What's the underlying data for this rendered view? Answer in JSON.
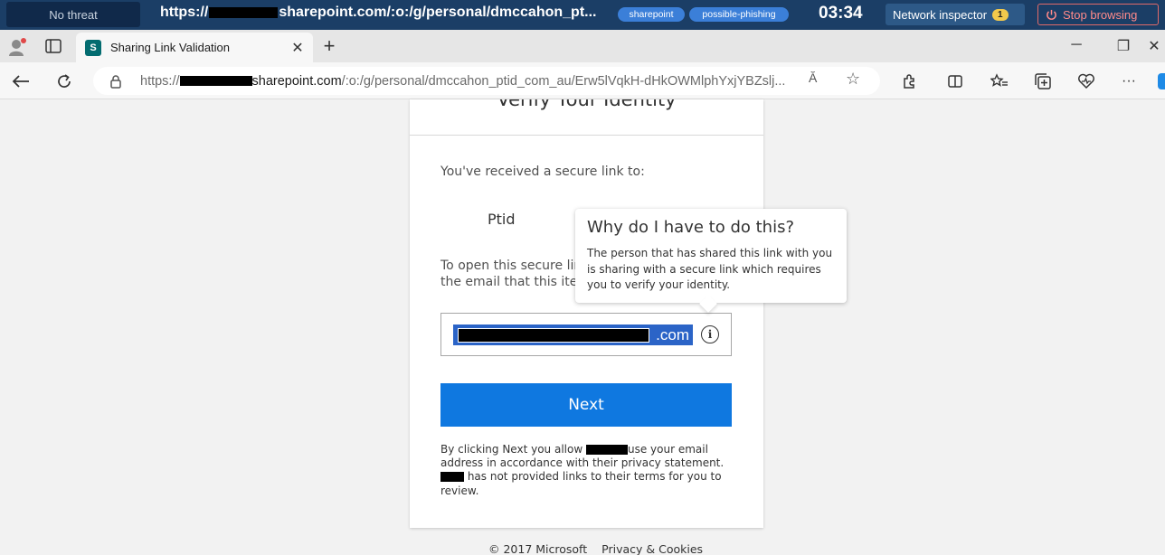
{
  "inspector": {
    "threat_label": "No threat",
    "url_prefix": "https://",
    "url_suffix": "sharepoint.com/:o:/g/personal/dmccahon_pt...",
    "tags": [
      "sharepoint",
      "possible-phishing"
    ],
    "timer": "03:34",
    "network_label": "Network inspector",
    "network_count": "1",
    "stop_label": "Stop browsing"
  },
  "browser": {
    "tab_title": "Sharing Link Validation",
    "tab_favicon": "S",
    "url_scheme": "https://",
    "url_host": "sharepoint.com",
    "url_path": "/:o:/g/personal/dmccahon_ptid_com_au/Erw5lVqkH-dHkOWMlphYxjYBZslj...",
    "read_aloud_icon": "Ă",
    "star_icon": "☆"
  },
  "page": {
    "title": "Verify Your Identity",
    "received_text": "You've received a secure link to:",
    "item_name": "Ptid",
    "open_line1": "To open this secure lin",
    "open_line2": "the email that this item",
    "email_suffix": ".com",
    "next_label": "Next",
    "legal_1": "By clicking Next you allow",
    "legal_2": "use your email address in accordance with their privacy statement.",
    "legal_3": "has not provided links to their terms for you to review.",
    "tooltip_title": "Why do I have to do this?",
    "tooltip_body": "The person that has shared this link with you is sharing with a secure link which requires you to verify your identity.",
    "footer_copyright": "© 2017 Microsoft",
    "footer_privacy": "Privacy & Cookies"
  }
}
